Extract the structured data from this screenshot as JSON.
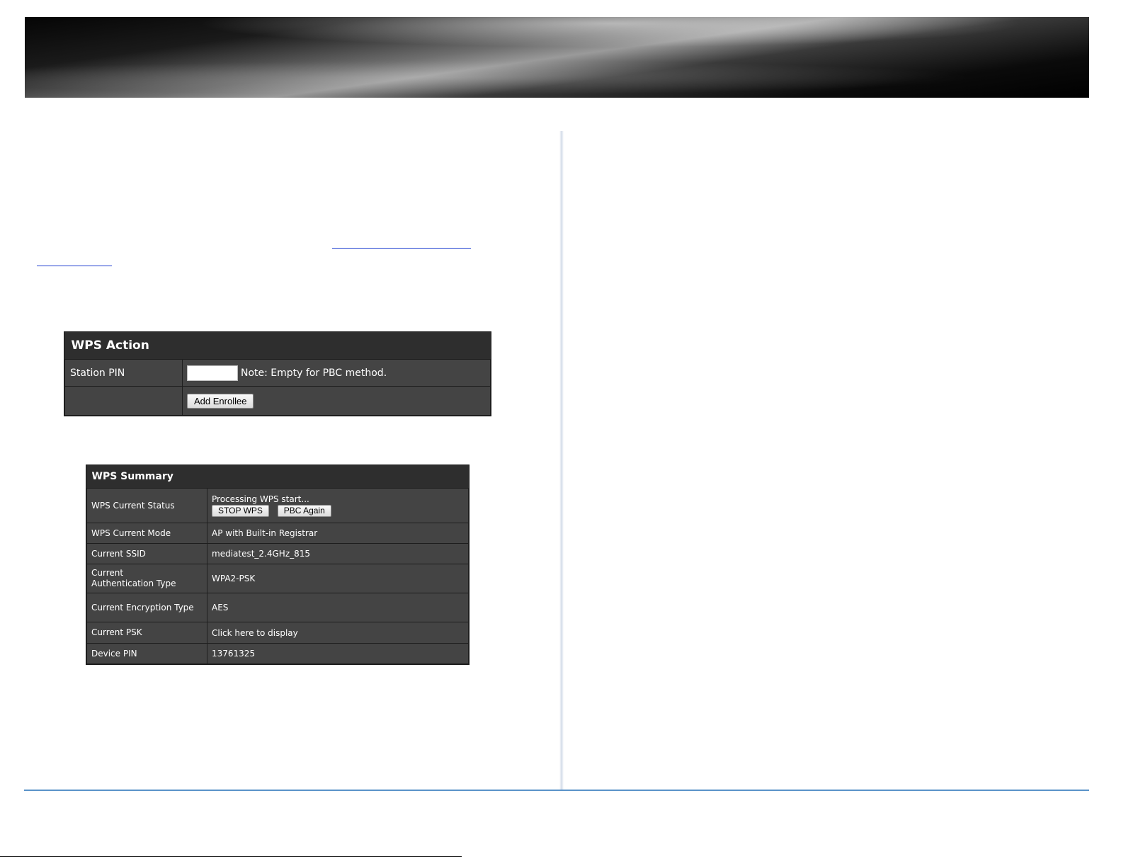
{
  "wps_action": {
    "title": "WPS Action",
    "station_pin_label": "Station PIN",
    "station_pin_value": "",
    "note": "Note: Empty for PBC method.",
    "add_enrollee_label": "Add Enrollee"
  },
  "wps_summary": {
    "title": "WPS Summary",
    "rows": [
      {
        "label": "WPS Current Status",
        "value": "Processing WPS start..."
      },
      {
        "label": "WPS Current Mode",
        "value": "AP with Built-in Registrar"
      },
      {
        "label": "Current SSID",
        "value": "mediatest_2.4GHz_815"
      },
      {
        "label": "Current Authentication Type",
        "value": "WPA2-PSK"
      },
      {
        "label": "Current Encryption Type",
        "value": "AES"
      },
      {
        "label": "Current PSK",
        "value": "Click here to display"
      },
      {
        "label": "Device PIN",
        "value": "13761325"
      }
    ],
    "stop_wps_label": "STOP WPS",
    "pbc_again_label": "PBC Again"
  }
}
